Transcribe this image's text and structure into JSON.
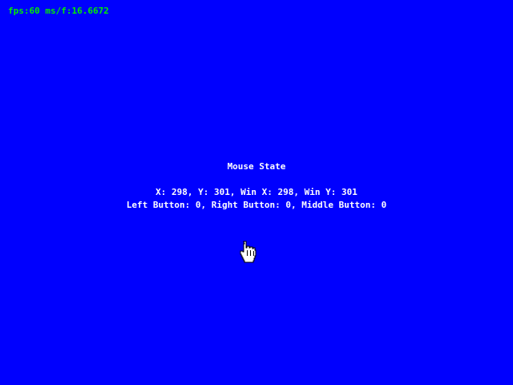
{
  "overlay": {
    "fps_text": "fps:60 ms/f:16.6672"
  },
  "panel": {
    "title": "Mouse State",
    "coords_text": "X: 298, Y: 301, Win X: 298, Win Y: 301",
    "buttons_text": "Left Button: 0, Right Button: 0, Middle Button: 0"
  },
  "colors": {
    "background": "#0000fe",
    "fps_text": "#00ee00",
    "text": "#ffffff"
  },
  "cursor": {
    "icon": "hand-pointer-icon"
  }
}
